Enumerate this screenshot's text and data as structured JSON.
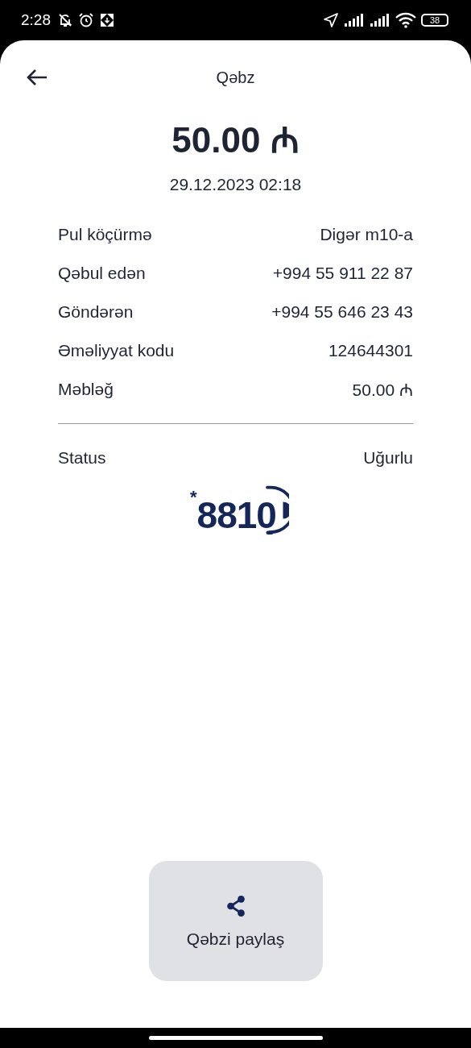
{
  "status_bar": {
    "time": "2:28",
    "battery": "38"
  },
  "header": {
    "title": "Qəbz"
  },
  "amount": "50.00 ₼",
  "date": "29.12.2023 02:18",
  "details": [
    {
      "label": "Pul köçürmə",
      "value": "Digər m10-a"
    },
    {
      "label": "Qəbul edən",
      "value": "+994 55 911 22 87"
    },
    {
      "label": "Göndərən",
      "value": "+994 55 646 23 43"
    },
    {
      "label": "Əməliyyat kodu",
      "value": "124644301"
    },
    {
      "label": "Məbləğ",
      "value": "50.00 ₼"
    }
  ],
  "status": {
    "label": "Status",
    "value": "Uğurlu"
  },
  "logo": {
    "mark": "*",
    "number": "8810"
  },
  "share_button": {
    "label": "Qəbzi paylaş"
  }
}
